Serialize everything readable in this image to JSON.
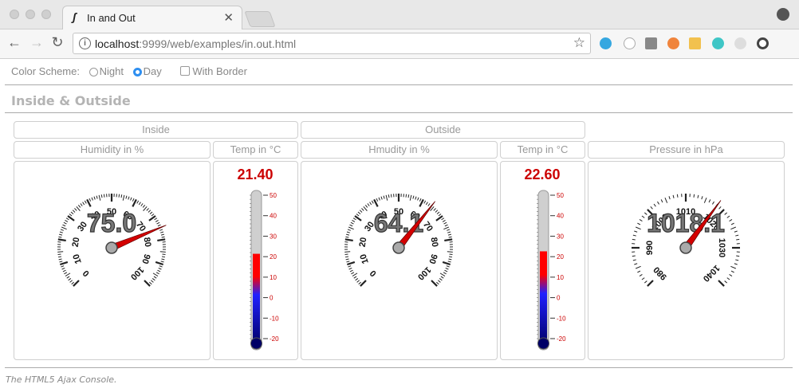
{
  "browser": {
    "tab_title": "In and Out",
    "url_host": "localhost",
    "url_rest": ":9999/web/examples/in.out.html"
  },
  "options": {
    "color_scheme_label": "Color Scheme:",
    "night_label": "Night",
    "day_label": "Day",
    "selected_scheme": "Day",
    "border_label": "With Border",
    "border_checked": false
  },
  "page_heading": "Inside & Outside",
  "groups": {
    "inside": "Inside",
    "outside": "Outside"
  },
  "columns": {
    "inside_humidity": "Humidity in %",
    "inside_temp": "Temp in °C",
    "outside_humidity": "Hmudity in %",
    "outside_temp": "Temp in °C",
    "pressure": "Pressure in hPa"
  },
  "gauges": {
    "inside_humidity": {
      "value": 75.0,
      "display": "75.0",
      "min": 0,
      "max": 100,
      "ticks": [
        "0",
        "10",
        "20",
        "30",
        "40",
        "50",
        "60",
        "70",
        "80",
        "90",
        "100"
      ]
    },
    "outside_humidity": {
      "value": 64.1,
      "display": "64.1",
      "min": 0,
      "max": 100,
      "ticks": [
        "0",
        "10",
        "20",
        "30",
        "40",
        "50",
        "60",
        "70",
        "80",
        "90",
        "100"
      ]
    },
    "pressure": {
      "value": 1018.1,
      "display": "1018.1",
      "min": 980,
      "max": 1040,
      "ticks": [
        "980",
        "990",
        "1000",
        "1010",
        "1020",
        "1030",
        "1040"
      ]
    }
  },
  "thermometers": {
    "inside_temp": {
      "value": 21.4,
      "display": "21.40"
    },
    "outside_temp": {
      "value": 22.6,
      "display": "22.60"
    },
    "scale": [
      "50",
      "40",
      "30",
      "20",
      "10",
      "0",
      "-10",
      "-20"
    ],
    "min": -20,
    "max": 50
  },
  "footer": "The HTML5 Ajax Console.",
  "colors": {
    "needle": "#d40000",
    "value_red": "#cc0000",
    "radio_accent": "#2f8ff0"
  }
}
